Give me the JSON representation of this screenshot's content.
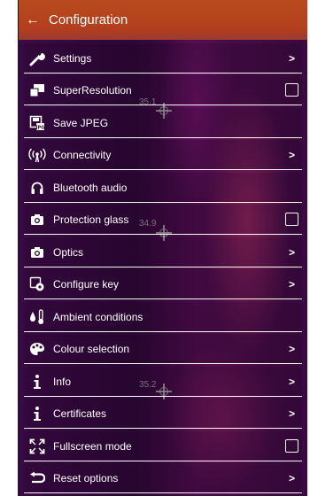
{
  "header": {
    "title": "Configuration",
    "back_icon": "arrow-left-icon"
  },
  "menu": {
    "items": [
      {
        "label": "Settings",
        "icon": "wrench-icon",
        "control": "chevron"
      },
      {
        "label": "SuperResolution",
        "icon": "superresolution-icon",
        "control": "checkbox",
        "checked": false
      },
      {
        "label": "Save JPEG",
        "icon": "save-jpeg-icon",
        "control": "none"
      },
      {
        "label": "Connectivity",
        "icon": "wireless-icon",
        "control": "chevron"
      },
      {
        "label": "Bluetooth audio",
        "icon": "headphones-icon",
        "control": "none"
      },
      {
        "label": "Protection glass",
        "icon": "camera-icon",
        "control": "checkbox",
        "checked": false
      },
      {
        "label": "Optics",
        "icon": "camera-icon",
        "control": "chevron"
      },
      {
        "label": "Configure key",
        "icon": "configure-key-icon",
        "control": "chevron"
      },
      {
        "label": "Ambient conditions",
        "icon": "ambient-conditions-icon",
        "control": "none"
      },
      {
        "label": "Colour selection",
        "icon": "palette-icon",
        "control": "chevron"
      },
      {
        "label": "Info",
        "icon": "info-icon",
        "control": "chevron"
      },
      {
        "label": "Certificates",
        "icon": "info-icon",
        "control": "chevron"
      },
      {
        "label": "Fullscreen mode",
        "icon": "fullscreen-icon",
        "control": "checkbox",
        "checked": false
      },
      {
        "label": "Reset options",
        "icon": "reset-icon",
        "control": "chevron"
      }
    ]
  },
  "overlay": {
    "markers": [
      {
        "temp": "35.1"
      },
      {
        "temp": "34.9"
      },
      {
        "temp": "35.2"
      }
    ]
  },
  "colors": {
    "header": "#b84a1c",
    "row_divider": "#ffffff",
    "background": "#3a0a44"
  }
}
